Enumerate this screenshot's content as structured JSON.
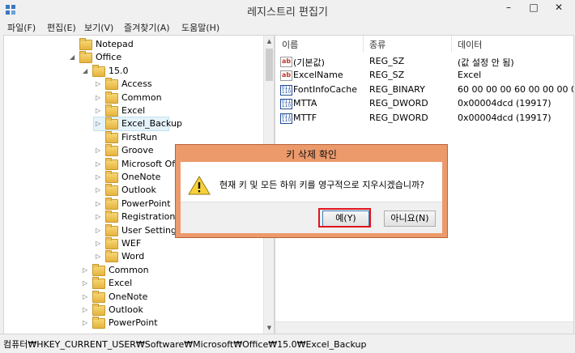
{
  "window": {
    "title": "레지스트리 편집기",
    "minimize": "–",
    "maximize": "□",
    "close": "✕"
  },
  "menu": [
    "파일(F)",
    "편집(E)",
    "보기(V)",
    "즐겨찾기(A)",
    "도움말(H)"
  ],
  "tree": [
    {
      "label": "Notepad",
      "expander": "",
      "open": true
    },
    {
      "label": "Office",
      "expander": "◢",
      "open": true
    },
    {
      "label": "15.0",
      "expander": "◢",
      "open": true
    },
    {
      "label": "Access",
      "expander": "▷"
    },
    {
      "label": "Common",
      "expander": "▷"
    },
    {
      "label": "Excel",
      "expander": "▷"
    },
    {
      "label": "Excel_Backup",
      "expander": "▷",
      "selected": true
    },
    {
      "label": "FirstRun",
      "expander": ""
    },
    {
      "label": "Groove",
      "expander": "▷"
    },
    {
      "label": "Microsoft Offi",
      "expander": "▷"
    },
    {
      "label": "OneNote",
      "expander": "▷"
    },
    {
      "label": "Outlook",
      "expander": "▷"
    },
    {
      "label": "PowerPoint",
      "expander": "▷"
    },
    {
      "label": "Registration",
      "expander": "▷"
    },
    {
      "label": "User Settings",
      "expander": "▷"
    },
    {
      "label": "WEF",
      "expander": "▷"
    },
    {
      "label": "Word",
      "expander": "▷"
    },
    {
      "label": "Common",
      "expander": "▷"
    },
    {
      "label": "Excel",
      "expander": "▷"
    },
    {
      "label": "OneNote",
      "expander": "▷"
    },
    {
      "label": "Outlook",
      "expander": "▷"
    },
    {
      "label": "PowerPoint",
      "expander": "▷"
    }
  ],
  "list": {
    "headers": [
      "이름",
      "종류",
      "데이터"
    ],
    "rows": [
      {
        "icon": "ab",
        "name": "(기본값)",
        "type": "REG_SZ",
        "data": "(값 설정 안 됨)"
      },
      {
        "icon": "ab",
        "name": "ExcelName",
        "type": "REG_SZ",
        "data": "Excel"
      },
      {
        "icon": "bin",
        "name": "FontInfoCache",
        "type": "REG_BINARY",
        "data": "60 00 00 00 60 00 00 00 00"
      },
      {
        "icon": "bin",
        "name": "MTTA",
        "type": "REG_DWORD",
        "data": "0x00004dcd (19917)"
      },
      {
        "icon": "bin",
        "name": "MTTF",
        "type": "REG_DWORD",
        "data": "0x00004dcd (19917)"
      }
    ]
  },
  "status": {
    "path": "컴퓨터₩HKEY_CURRENT_USER₩Software₩Microsoft₩Office₩15.0₩Excel_Backup"
  },
  "dialog": {
    "title": "키 삭제 확인",
    "message": "현재 키 및 모든 하위 키를 영구적으로 지우시겠습니까?",
    "yes_label": "예(Y)",
    "no_label": "아니요(N)"
  },
  "colors": {
    "dialog_frame": "#ec9a6b",
    "highlight_outline": "#e0141e",
    "selection": "#e5f3fb"
  },
  "icons": {
    "app": "regedit-icon",
    "folder": "folder-icon",
    "string_value": "string-value-icon",
    "binary_value": "binary-value-icon",
    "warning": "warning-icon"
  }
}
